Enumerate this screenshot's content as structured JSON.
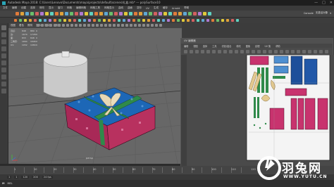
{
  "window": {
    "title": "Autodesk Maya 2018: C:\\Users\\Lenovo\\Documents\\maya\\projects\\default\\scenes\\礼盒.mb* --- polySurface10",
    "minimize": "—",
    "maximize": "□",
    "close": "✕"
  },
  "menubar": [
    "文件",
    "编辑",
    "创建",
    "选择",
    "修改",
    "显示",
    "窗口",
    "网格",
    "编辑网格",
    "网格工具",
    "网格显示",
    "曲线",
    "曲面",
    "变形",
    "UV",
    "生成",
    "缓存",
    "Arnold",
    "帮助"
  ],
  "shelf": {
    "mode": "建模",
    "right_labels": [
      "Console",
      "无激活对象",
      "▾"
    ],
    "tabs": [
      "曲线/曲面",
      "多边形建模",
      "雕刻",
      "绑定",
      "动画",
      "渲染",
      "FX",
      "FX 缓存",
      "自定义",
      "Arnold",
      "Bifrost",
      "MASH",
      "运动图形",
      "XGen"
    ]
  },
  "viewport": {
    "menu": [
      "视图",
      "着色",
      "照明",
      "显示",
      "渲染器",
      "面板"
    ],
    "stats": [
      {
        "label": "顶点:",
        "a": "848",
        "b": "880",
        "c": "0"
      },
      {
        "label": "边:",
        "a": "1679",
        "b": "1728",
        "c": "0"
      },
      {
        "label": "面:",
        "a": "833",
        "b": "848",
        "c": "0"
      },
      {
        "label": "三角形:",
        "a": "1664",
        "b": "1696",
        "c": "0"
      },
      {
        "label": "UV:",
        "a": "1052",
        "b": "1084",
        "c": "0"
      }
    ],
    "camera": "persp",
    "colors": {
      "ground": "#676767",
      "box_top": "#1d67b6",
      "box_side": "#b02b5a",
      "ribbon": "#7cc47a",
      "bow": "#e6d7b5"
    }
  },
  "uv_editor": {
    "title": "UV 编辑器",
    "menu": [
      "编辑",
      "视图",
      "选择",
      "工具",
      "切割/缝合",
      "修改",
      "图像",
      "纹理",
      "UV 集",
      "帮助"
    ],
    "colors": {
      "blue": "#1d4f9a",
      "pink": "#c8336e",
      "green": "#2f8a4a",
      "cream": "#e3c98f"
    }
  },
  "timeline": {
    "frames": [
      "1",
      "10",
      "20",
      "30",
      "40",
      "50",
      "60",
      "70",
      "80",
      "90",
      "100",
      "110",
      "120"
    ],
    "range_start": "1",
    "range_end": "120",
    "range_end2": "200",
    "fps": "24 fps"
  },
  "cmdline": {
    "prefix": "MEL",
    "logo": "M"
  },
  "watermark": {
    "brand": "羽兔网",
    "url": "WWW.YUTU.CN"
  }
}
